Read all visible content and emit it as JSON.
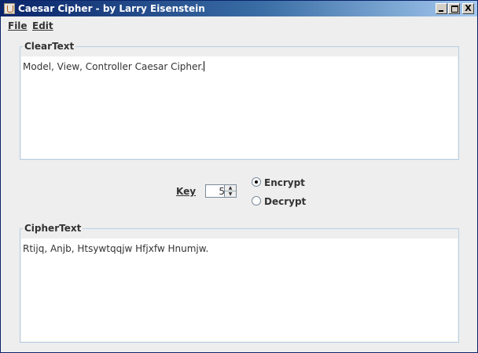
{
  "window": {
    "title": "Caesar Cipher - by Larry Eisenstein",
    "controls": {
      "minimize": "_",
      "maximize": "□",
      "close": "X"
    }
  },
  "menubar": {
    "file": "File",
    "edit": "Edit"
  },
  "cleartext": {
    "legend": "ClearText",
    "value": "Model, View, Controller Caesar Cipher."
  },
  "key": {
    "label": "Key",
    "value": "5"
  },
  "mode": {
    "options": [
      {
        "label": "Encrypt",
        "selected": true
      },
      {
        "label": "Decrypt",
        "selected": false
      }
    ]
  },
  "ciphertext": {
    "legend": "CipherText",
    "value": "Rtijq, Anjb, Htsywtqqjw Hfjxfw Hnumjw."
  }
}
